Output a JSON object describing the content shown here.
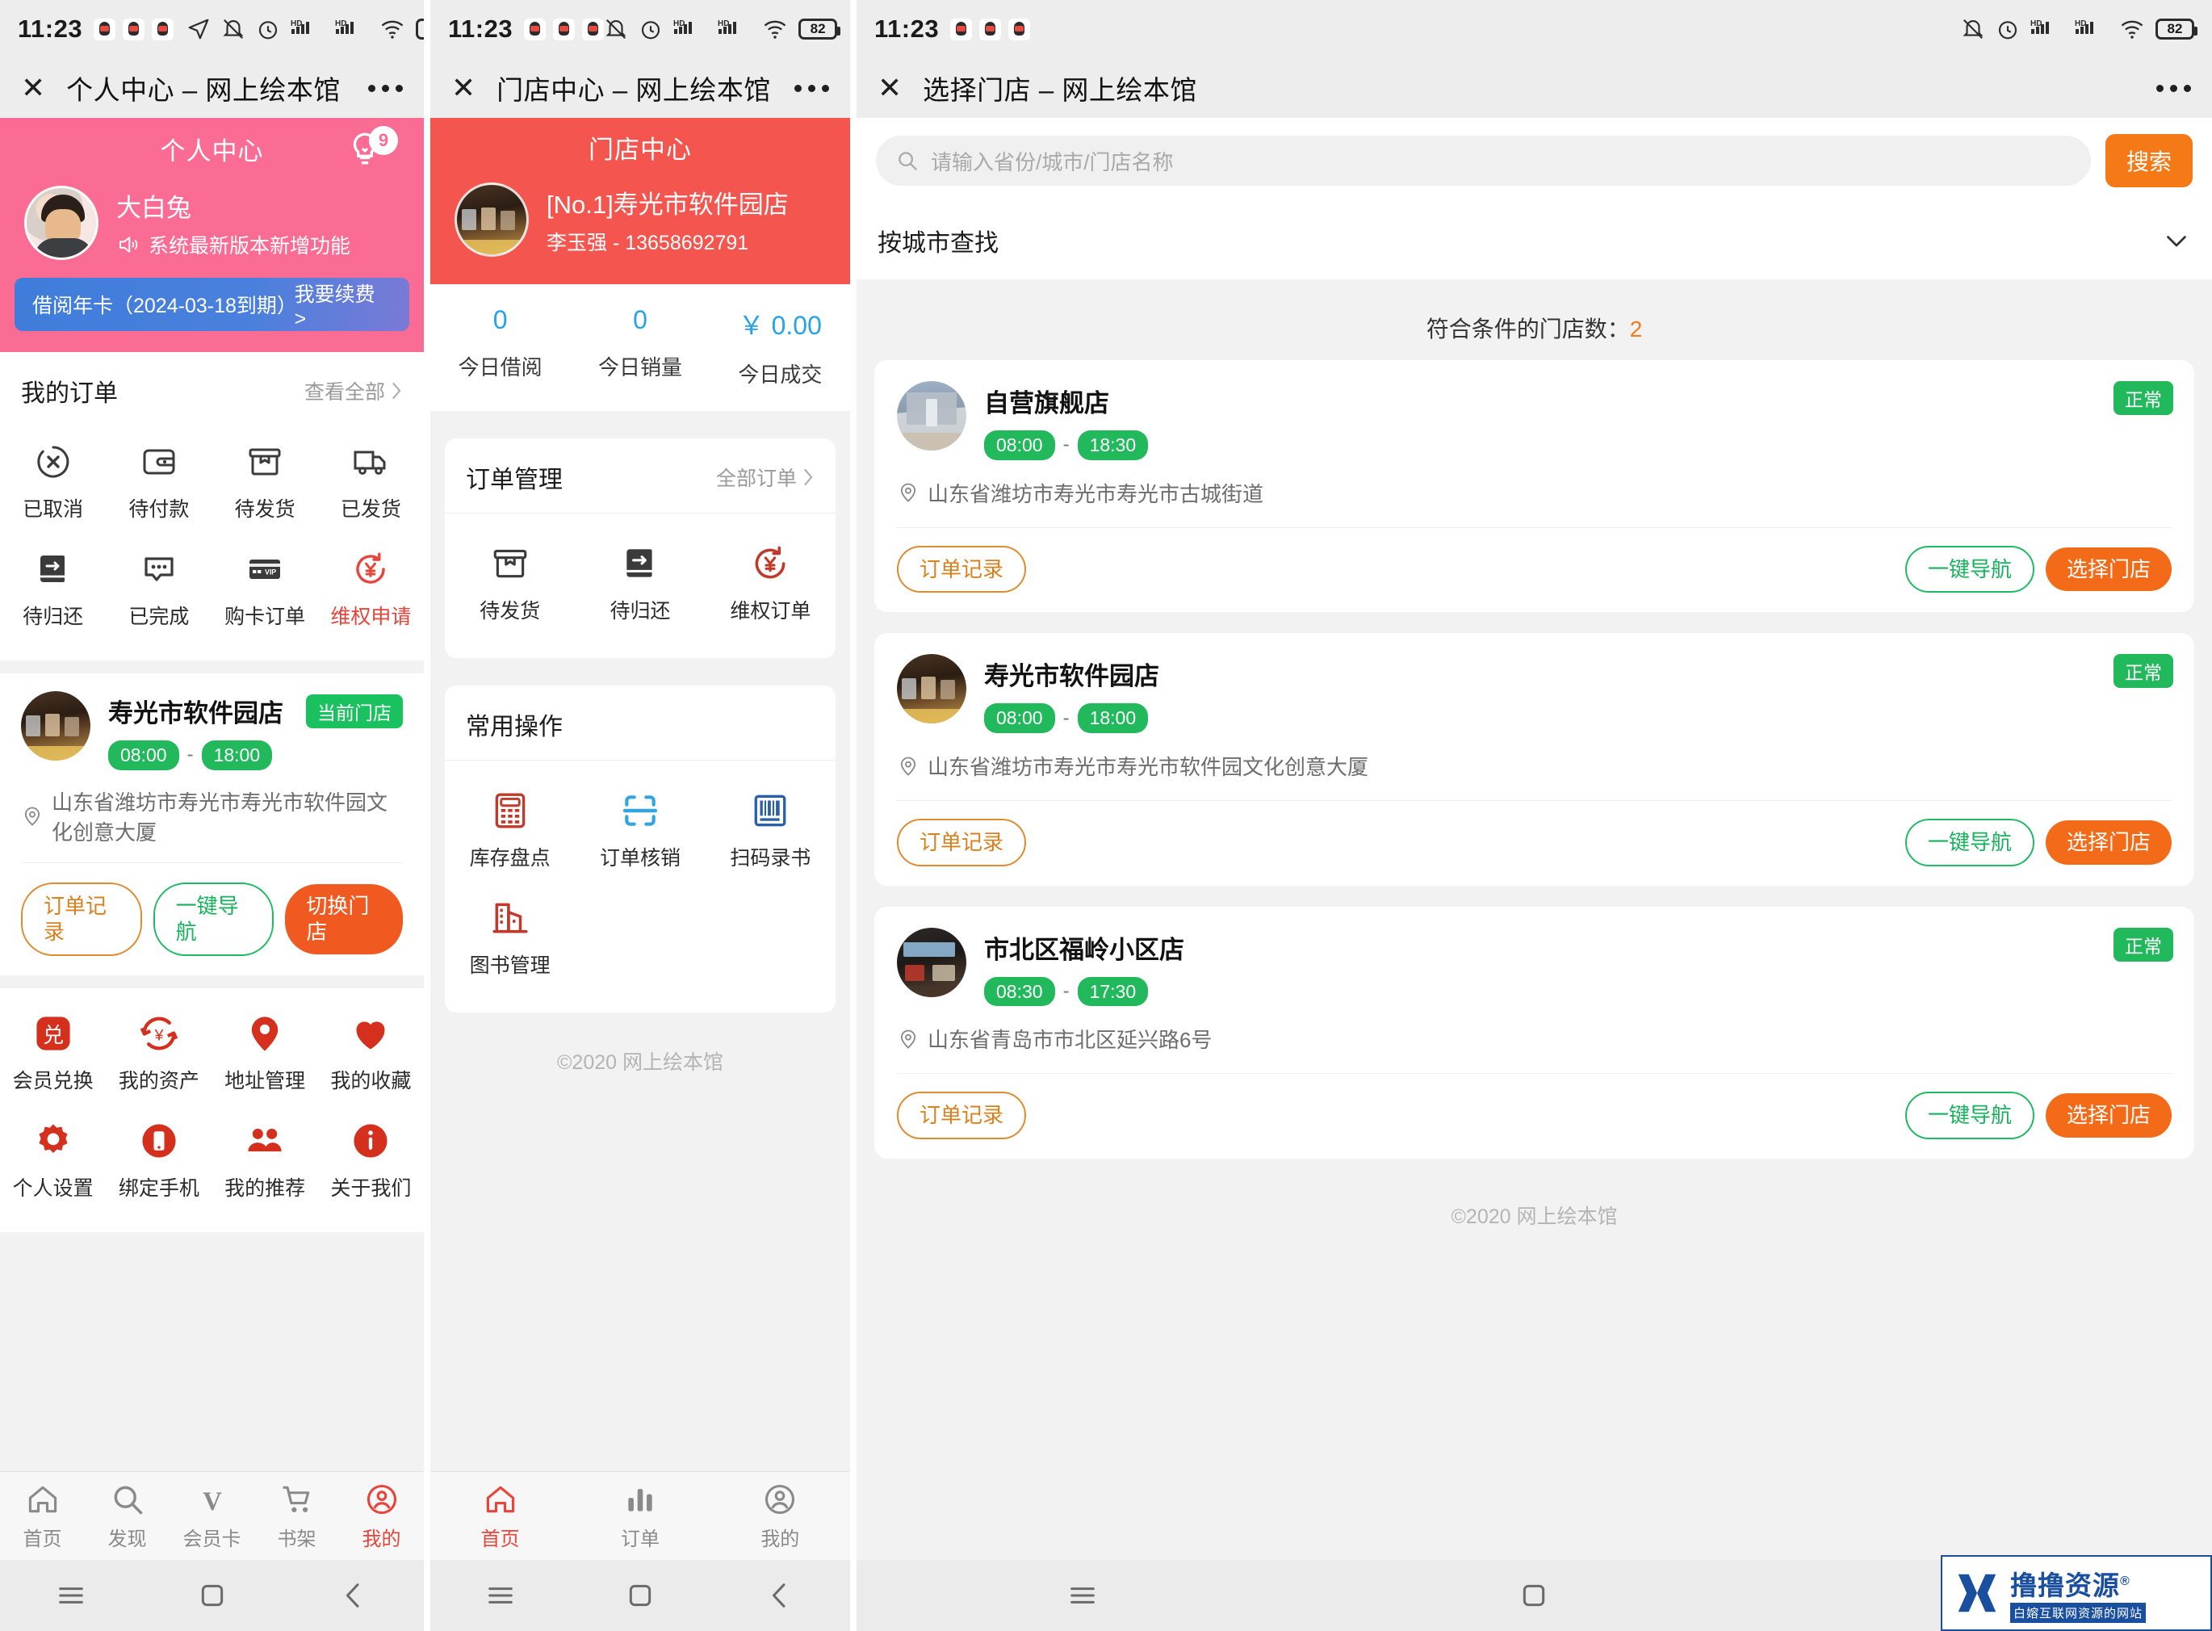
{
  "status_bar": {
    "time": "11:23",
    "battery": "82",
    "icons": [
      "qq-icon",
      "qq-icon",
      "qq-icon",
      "location-arrow-icon",
      "mute-bell-icon",
      "alarm-clock-icon",
      "hd-signal-icon",
      "signal-icon",
      "wifi-icon",
      "battery-icon"
    ]
  },
  "panel1": {
    "nav": {
      "close": "✕",
      "title": "个人中心 – 网上绘本馆",
      "more": "•••"
    },
    "hero": {
      "title": "个人中心",
      "bulb_badge": "9",
      "user_name": "大白兔",
      "user_notice": "系统最新版本新增功能",
      "card_label": "借阅年卡（2024-03-18到期）",
      "card_action": "我要续费 >"
    },
    "orders": {
      "title": "我的订单",
      "more": "查看全部",
      "items": [
        {
          "label": "已取消",
          "icon": "cancel-circle-icon",
          "highlight": false
        },
        {
          "label": "待付款",
          "icon": "wallet-icon",
          "highlight": false
        },
        {
          "label": "待发货",
          "icon": "package-icon",
          "highlight": false
        },
        {
          "label": "已发货",
          "icon": "truck-icon",
          "highlight": false
        },
        {
          "label": "待归还",
          "icon": "book-return-icon",
          "highlight": false
        },
        {
          "label": "已完成",
          "icon": "comment-dots-icon",
          "highlight": false
        },
        {
          "label": "购卡订单",
          "icon": "vip-card-icon",
          "highlight": false
        },
        {
          "label": "维权申请",
          "icon": "refund-yuan-icon",
          "highlight": true
        }
      ]
    },
    "store": {
      "name": "寿光市软件园店",
      "badge": "当前门店",
      "open": "08:00",
      "close": "18:00",
      "address": "山东省潍坊市寿光市寿光市软件园文化创意大厦",
      "btn_orders": "订单记录",
      "btn_nav": "一键导航",
      "btn_switch": "切换门店"
    },
    "functions": [
      {
        "label": "会员兑换",
        "icon": "exchange-square-icon"
      },
      {
        "label": "我的资产",
        "icon": "yuan-refresh-icon"
      },
      {
        "label": "地址管理",
        "icon": "map-pin-icon"
      },
      {
        "label": "我的收藏",
        "icon": "heart-icon"
      },
      {
        "label": "个人设置",
        "icon": "gear-icon"
      },
      {
        "label": "绑定手机",
        "icon": "phone-icon"
      },
      {
        "label": "我的推荐",
        "icon": "people-icon"
      },
      {
        "label": "关于我们",
        "icon": "info-icon"
      }
    ],
    "tabs": [
      {
        "label": "首页",
        "icon": "home-icon",
        "active": false
      },
      {
        "label": "发现",
        "icon": "search-icon",
        "active": false
      },
      {
        "label": "会员卡",
        "icon": "vip-v-icon",
        "active": false
      },
      {
        "label": "书架",
        "icon": "cart-icon",
        "active": false
      },
      {
        "label": "我的",
        "icon": "user-circle-icon",
        "active": true
      }
    ]
  },
  "panel2": {
    "nav": {
      "close": "✕",
      "title": "门店中心 – 网上绘本馆",
      "more": "•••"
    },
    "hero": {
      "title": "门店中心",
      "store_name": "[No.1]寿光市软件园店",
      "store_contact": "李玉强 - 13658692791"
    },
    "stats": [
      {
        "value": "0",
        "label": "今日借阅"
      },
      {
        "value": "0",
        "label": "今日销量"
      },
      {
        "value": "￥ 0.00",
        "label": "今日成交"
      }
    ],
    "order_mgmt": {
      "title": "订单管理",
      "more": "全部订单",
      "items": [
        {
          "label": "待发货",
          "icon": "package-icon"
        },
        {
          "label": "待归还",
          "icon": "book-return-icon"
        },
        {
          "label": "维权订单",
          "icon": "refund-yuan-icon"
        }
      ]
    },
    "common_ops": {
      "title": "常用操作",
      "items": [
        {
          "label": "库存盘点",
          "icon": "calculator-icon"
        },
        {
          "label": "订单核销",
          "icon": "scan-icon"
        },
        {
          "label": "扫码录书",
          "icon": "barcode-icon"
        },
        {
          "label": "图书管理",
          "icon": "building-icon"
        }
      ]
    },
    "footer": "©2020 网上绘本馆",
    "tabs": [
      {
        "label": "首页",
        "icon": "home-icon",
        "active": true
      },
      {
        "label": "订单",
        "icon": "bar-chart-icon",
        "active": false
      },
      {
        "label": "我的",
        "icon": "user-circle-icon",
        "active": false
      }
    ]
  },
  "panel3": {
    "nav": {
      "close": "✕",
      "title": "选择门店 – 网上绘本馆",
      "more": "•••"
    },
    "search": {
      "placeholder": "请输入省份/城市/门店名称",
      "value": "",
      "button": "搜索"
    },
    "filter": {
      "label": "按城市查找",
      "icon": "chevron-down-icon"
    },
    "count_prefix": "符合条件的门店数：",
    "count_value": "2",
    "stores": [
      {
        "name": "自营旗舰店",
        "status": "正常",
        "open": "08:00",
        "close": "18:30",
        "address": "山东省潍坊市寿光市寿光市古城街道",
        "thumb": "flag",
        "btn_orders": "订单记录",
        "btn_nav": "一键导航",
        "btn_select": "选择门店"
      },
      {
        "name": "寿光市软件园店",
        "status": "正常",
        "open": "08:00",
        "close": "18:00",
        "address": "山东省潍坊市寿光市寿光市软件园文化创意大厦",
        "thumb": "shop",
        "btn_orders": "订单记录",
        "btn_nav": "一键导航",
        "btn_select": "选择门店"
      },
      {
        "name": "市北区福岭小区店",
        "status": "正常",
        "open": "08:30",
        "close": "17:30",
        "address": "山东省青岛市市北区延兴路6号",
        "thumb": "mall",
        "btn_orders": "订单记录",
        "btn_nav": "一键导航",
        "btn_select": "选择门店"
      }
    ],
    "footer": "©2020 网上绘本馆"
  },
  "watermark": {
    "main": "撸撸资源",
    "reg": "®",
    "sub": "白嫆互联网资源的网站"
  },
  "colors": {
    "pink": "#fa6c93",
    "red": "#f4554e",
    "orange": "#f57a17",
    "green": "#21b95b",
    "blue": "#25a3e8",
    "brand_red": "#e8443a"
  }
}
